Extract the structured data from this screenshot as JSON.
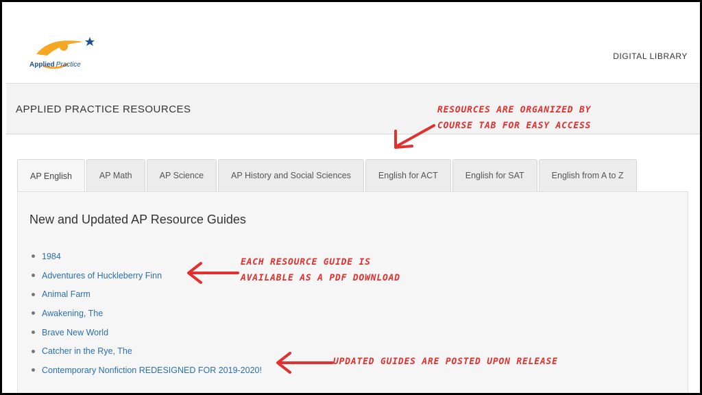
{
  "logo": {
    "word1": "Applied",
    "word2": "Practice"
  },
  "nav": {
    "digital_library": "DIGITAL LIBRARY"
  },
  "section": {
    "title": "APPLIED PRACTICE RESOURCES"
  },
  "tabs": [
    {
      "label": "AP English",
      "active": true
    },
    {
      "label": "AP Math"
    },
    {
      "label": "AP Science"
    },
    {
      "label": "AP History and Social Sciences"
    },
    {
      "label": "English for ACT"
    },
    {
      "label": "English for SAT"
    },
    {
      "label": "English from A to Z"
    }
  ],
  "panel": {
    "title": "New and Updated AP Resource Guides",
    "guides": [
      "1984",
      "Adventures of Huckleberry Finn",
      "Animal Farm",
      "Awakening, The",
      "Brave New World",
      "Catcher in the Rye, The",
      "Contemporary Nonfiction REDESIGNED FOR 2019-2020!"
    ]
  },
  "annotations": {
    "tabs_note": "Resources are organized by\ncourse tab for easy access",
    "pdf_note": "Each resource guide is\navailable as a PDF download",
    "updated_note": "Updated guides are posted upon release"
  },
  "colors": {
    "annotation": "#e0312f",
    "link": "#2a6fb0",
    "logo_orange": "#f5a623",
    "logo_blue": "#1a4fa0"
  }
}
